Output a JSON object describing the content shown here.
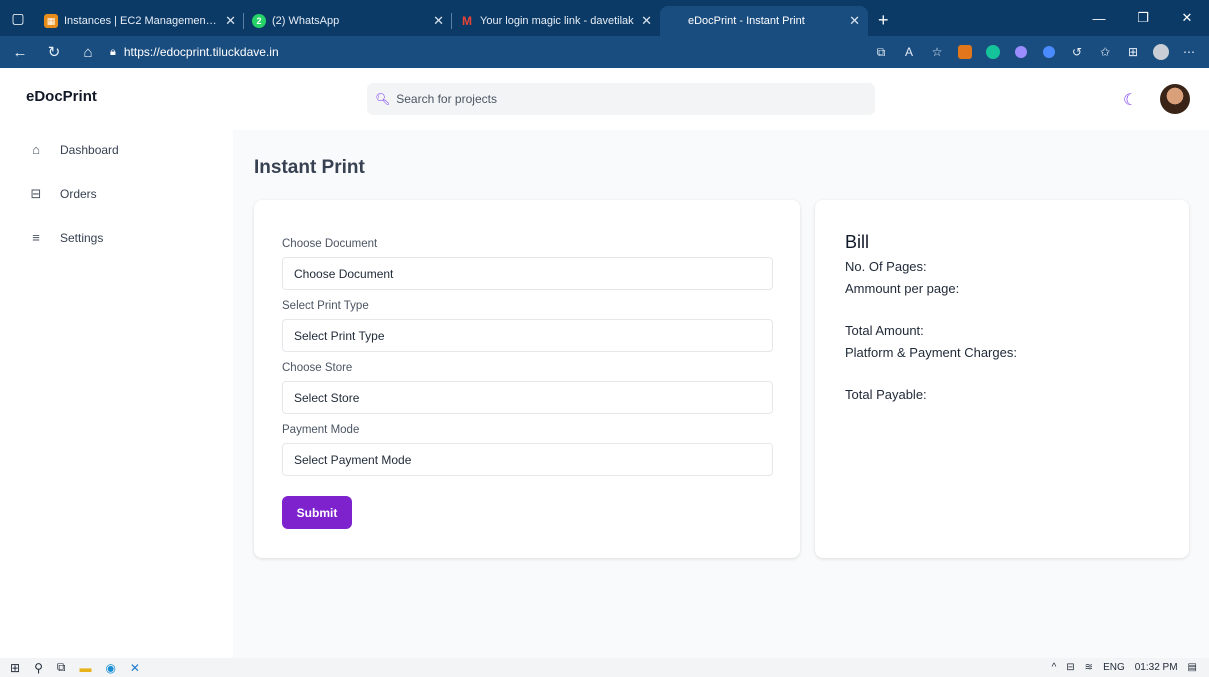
{
  "browser": {
    "tabs": [
      {
        "title": "Instances | EC2 Management Co",
        "fav_color": "#e88c1a",
        "fav_glyph": "▦"
      },
      {
        "title": "(2) WhatsApp",
        "fav_color": "#25d366",
        "fav_glyph": "2"
      },
      {
        "title": "Your login magic link - davetilak",
        "fav_color": "#c5221f",
        "fav_glyph": "M"
      },
      {
        "title": "eDocPrint - Instant Print",
        "fav_color": "#1a4d7f",
        "fav_glyph": ""
      }
    ],
    "url": "https://edocprint.tiluckdave.in"
  },
  "app": {
    "brand": "eDocPrint",
    "search_placeholder": "Search for projects",
    "accent": "#7e22ce"
  },
  "sidebar": {
    "items": [
      {
        "label": "Dashboard",
        "icon": "home-icon"
      },
      {
        "label": "Orders",
        "icon": "inbox-icon"
      },
      {
        "label": "Settings",
        "icon": "menu-icon"
      }
    ]
  },
  "main": {
    "title": "Instant Print",
    "form": {
      "document_label": "Choose Document",
      "document_value": "Choose Document",
      "print_type_label": "Select Print Type",
      "print_type_value": "Select Print Type",
      "store_label": "Choose Store",
      "store_value": "Select Store",
      "payment_label": "Payment Mode",
      "payment_value": "Select Payment Mode",
      "submit_label": "Submit"
    },
    "bill": {
      "title": "Bill",
      "pages": "No. Of Pages:",
      "per_page": "Ammount per page:",
      "total": "Total Amount:",
      "charges": "Platform & Payment Charges:",
      "payable": "Total Payable:"
    }
  },
  "taskbar": {
    "lang": "ENG",
    "time": "01:32 PM"
  }
}
